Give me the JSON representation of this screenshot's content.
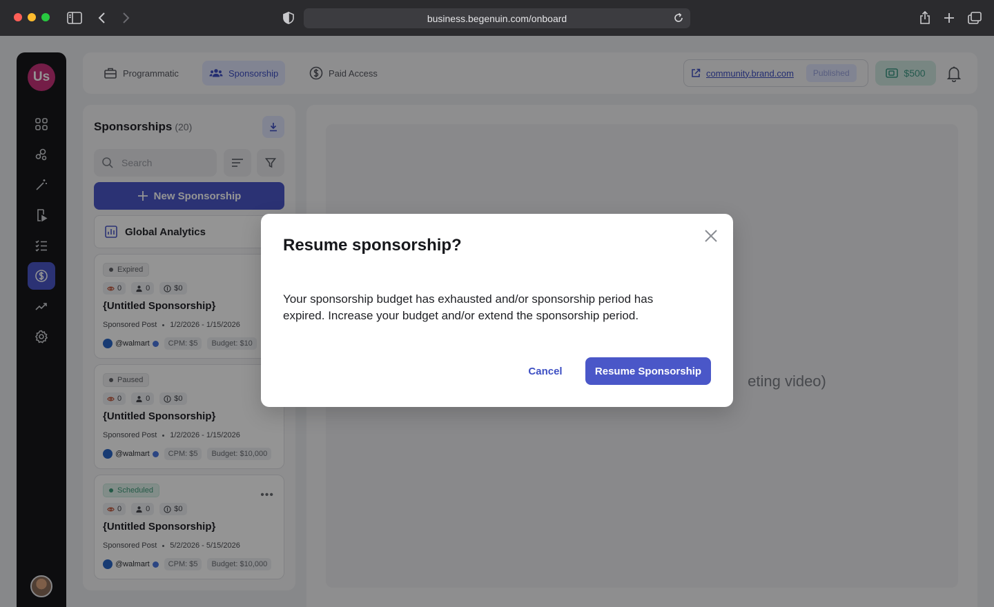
{
  "browser": {
    "url": "business.begenuin.com/onboard"
  },
  "app": {
    "logo_text": "Us"
  },
  "header": {
    "tabs": [
      {
        "label": "Programmatic",
        "icon": "briefcase-icon"
      },
      {
        "label": "Sponsorship",
        "icon": "users-icon",
        "active": true
      },
      {
        "label": "Paid Access",
        "icon": "dollar-circle-icon"
      }
    ],
    "community_url": "community.brand.com",
    "publish_status": "Published",
    "wallet_balance": "$500"
  },
  "list_panel": {
    "title": "Sponsorships",
    "count": "(20)",
    "search_placeholder": "Search",
    "new_button": "New Sponsorship",
    "analytics_label": "Global Analytics",
    "cards": [
      {
        "status": "Expired",
        "views": "0",
        "users": "0",
        "spend": "$0",
        "title": "{Untitled Sponsorship}",
        "type": "Sponsored Post",
        "dates": "1/2/2026 - 1/15/2026",
        "handle": "@walmart",
        "cpm": "CPM: $5",
        "budget": "Budget: $10"
      },
      {
        "status": "Paused",
        "views": "0",
        "users": "0",
        "spend": "$0",
        "title": "{Untitled Sponsorship}",
        "type": "Sponsored Post",
        "dates": "1/2/2026 - 1/15/2026",
        "handle": "@walmart",
        "cpm": "CPM: $5",
        "budget": "Budget: $10,000"
      },
      {
        "status": "Scheduled",
        "views": "0",
        "users": "0",
        "spend": "$0",
        "title": "{Untitled Sponsorship}",
        "type": "Sponsored Post",
        "dates": "5/2/2026 - 5/15/2026",
        "handle": "@walmart",
        "cpm": "CPM: $5",
        "budget": "Budget: $10,000"
      }
    ]
  },
  "main": {
    "placeholder": "eting video)"
  },
  "modal": {
    "title": "Resume sponsorship?",
    "body": "Your sponsorship budget has exhausted and/or sponsorship period has expired. Increase your budget and/or extend the sponsorship period.",
    "cancel_label": "Cancel",
    "confirm_label": "Resume Sponsorship"
  },
  "colors": {
    "accent": "#4a57c8",
    "sidebar": "#18181b",
    "scheduled": "#3e9a7a"
  }
}
